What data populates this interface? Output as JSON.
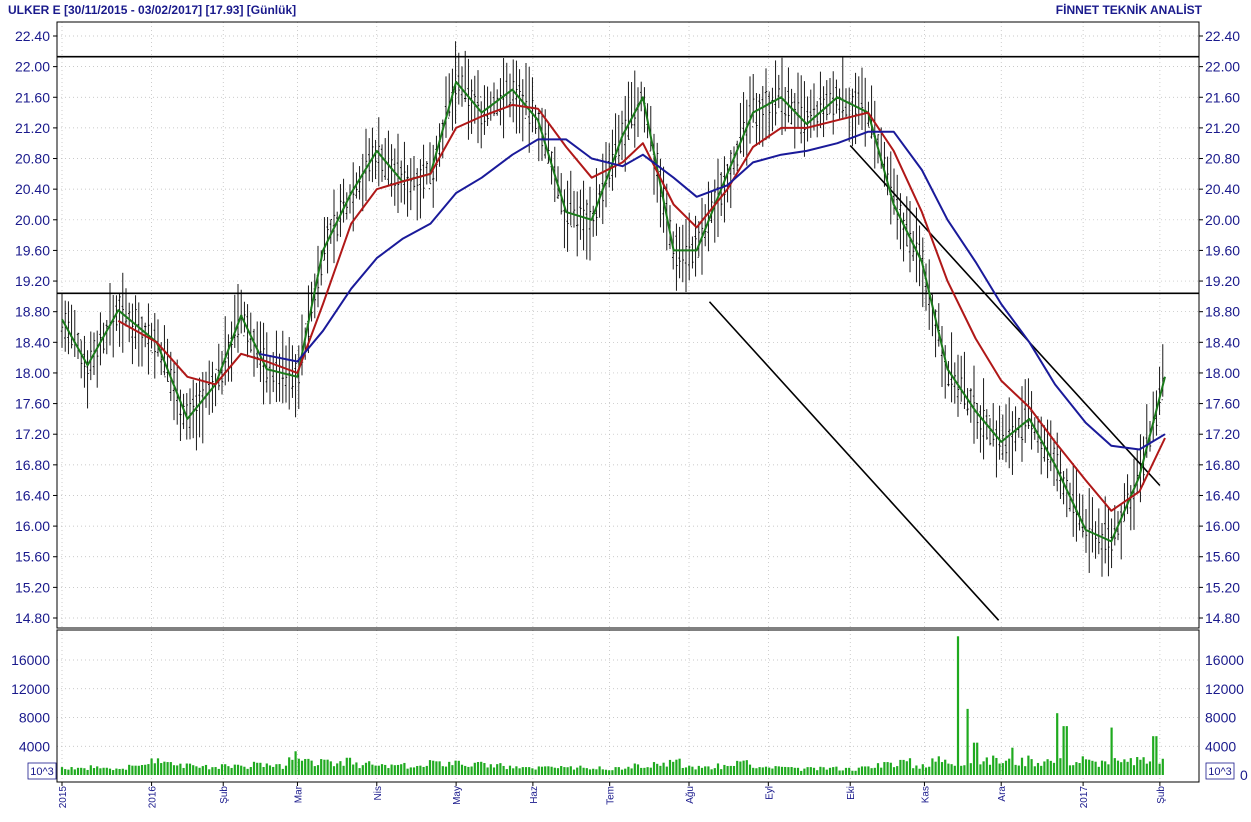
{
  "header": {
    "left": "ULKER E  [30/11/2015 - 03/02/2017]  [17.93]  [Günlük]",
    "right": "FİNNET TEKNİK ANALİST"
  },
  "volume_unit": "10^3",
  "colors": {
    "text": "#1a1a8c",
    "price_bars": "#000000",
    "ma_short": "#1a7a1a",
    "ma_mid": "#b01818",
    "ma_long": "#1a1a9a",
    "volume": "#1faa1f",
    "grid": "#b8b8b8"
  },
  "chart_data": [
    {
      "type": "ohlc_bar",
      "title": "ULKER E",
      "period": "30/11/2015 - 03/02/2017",
      "last": 17.93,
      "interval": "Günlük",
      "ylim": [
        14.75,
        22.55
      ],
      "yticks": [
        "22.40",
        "22.00",
        "21.60",
        "21.20",
        "20.80",
        "20.40",
        "20.00",
        "19.60",
        "19.20",
        "18.80",
        "18.40",
        "18.00",
        "17.60",
        "17.20",
        "16.80",
        "16.40",
        "16.00",
        "15.60",
        "15.20",
        "14.80"
      ],
      "xticks": [
        "2015",
        "2016",
        "Şub",
        "Mar",
        "Nis",
        "May",
        "Haz",
        "Tem",
        "Ağu",
        "Eyl",
        "Eki",
        "Kas",
        "Ara",
        "2017",
        "Şub"
      ],
      "grid": true,
      "horizontal_lines": [
        22.13,
        19.04
      ],
      "trend_lines": [
        {
          "from": {
            "date": "2016-08-09",
            "y": 18.93
          },
          "to": {
            "date": "2016-11-30",
            "y": 14.77
          }
        },
        {
          "from": {
            "date": "2016-10-03",
            "y": 20.97
          },
          "to": {
            "date": "2017-02-01",
            "y": 16.53
          }
        }
      ],
      "series": [
        {
          "name": "",
          "kind": "ma_short",
          "values": [
            [
              "2015-11-30",
              18.7
            ],
            [
              "2015-12-10",
              18.1
            ],
            [
              "2015-12-22",
              18.82
            ],
            [
              "2016-01-06",
              18.4
            ],
            [
              "2016-01-18",
              17.4
            ],
            [
              "2016-01-29",
              17.85
            ],
            [
              "2016-02-08",
              18.75
            ],
            [
              "2016-02-18",
              18.05
            ],
            [
              "2016-03-01",
              17.95
            ],
            [
              "2016-03-11",
              19.6
            ],
            [
              "2016-03-22",
              20.35
            ],
            [
              "2016-04-01",
              20.9
            ],
            [
              "2016-04-11",
              20.5
            ],
            [
              "2016-04-22",
              20.6
            ],
            [
              "2016-05-02",
              21.8
            ],
            [
              "2016-05-12",
              21.4
            ],
            [
              "2016-05-24",
              21.7
            ],
            [
              "2016-06-03",
              21.3
            ],
            [
              "2016-06-14",
              20.1
            ],
            [
              "2016-06-24",
              20.0
            ],
            [
              "2016-07-06",
              21.1
            ],
            [
              "2016-07-14",
              21.6
            ],
            [
              "2016-07-26",
              19.6
            ],
            [
              "2016-08-04",
              19.6
            ],
            [
              "2016-08-16",
              20.6
            ],
            [
              "2016-08-26",
              21.4
            ],
            [
              "2016-09-06",
              21.6
            ],
            [
              "2016-09-16",
              21.25
            ],
            [
              "2016-09-28",
              21.6
            ],
            [
              "2016-10-10",
              21.4
            ],
            [
              "2016-10-20",
              20.2
            ],
            [
              "2016-10-31",
              19.45
            ],
            [
              "2016-11-10",
              18.05
            ],
            [
              "2016-11-21",
              17.5
            ],
            [
              "2016-12-01",
              17.1
            ],
            [
              "2016-12-12",
              17.4
            ],
            [
              "2016-12-22",
              16.8
            ],
            [
              "2017-01-03",
              15.95
            ],
            [
              "2017-01-13",
              15.8
            ],
            [
              "2017-01-24",
              16.65
            ],
            [
              "2017-02-03",
              17.95
            ]
          ]
        },
        {
          "name": "",
          "kind": "ma_mid",
          "values": [
            [
              "2015-12-22",
              18.68
            ],
            [
              "2016-01-06",
              18.4
            ],
            [
              "2016-01-18",
              17.95
            ],
            [
              "2016-01-29",
              17.85
            ],
            [
              "2016-02-08",
              18.25
            ],
            [
              "2016-02-18",
              18.15
            ],
            [
              "2016-03-01",
              18.0
            ],
            [
              "2016-03-11",
              18.9
            ],
            [
              "2016-03-22",
              19.95
            ],
            [
              "2016-04-01",
              20.4
            ],
            [
              "2016-04-11",
              20.5
            ],
            [
              "2016-04-22",
              20.6
            ],
            [
              "2016-05-02",
              21.2
            ],
            [
              "2016-05-12",
              21.35
            ],
            [
              "2016-05-24",
              21.5
            ],
            [
              "2016-06-03",
              21.45
            ],
            [
              "2016-06-14",
              20.95
            ],
            [
              "2016-06-24",
              20.55
            ],
            [
              "2016-07-06",
              20.75
            ],
            [
              "2016-07-14",
              21.0
            ],
            [
              "2016-07-26",
              20.2
            ],
            [
              "2016-08-04",
              19.9
            ],
            [
              "2016-08-16",
              20.4
            ],
            [
              "2016-08-26",
              20.95
            ],
            [
              "2016-09-06",
              21.2
            ],
            [
              "2016-09-16",
              21.2
            ],
            [
              "2016-09-28",
              21.3
            ],
            [
              "2016-10-10",
              21.4
            ],
            [
              "2016-10-20",
              20.9
            ],
            [
              "2016-10-31",
              20.1
            ],
            [
              "2016-11-10",
              19.2
            ],
            [
              "2016-11-21",
              18.45
            ],
            [
              "2016-12-01",
              17.9
            ],
            [
              "2016-12-12",
              17.55
            ],
            [
              "2016-12-22",
              17.1
            ],
            [
              "2017-01-03",
              16.6
            ],
            [
              "2017-01-13",
              16.2
            ],
            [
              "2017-01-24",
              16.45
            ],
            [
              "2017-02-03",
              17.15
            ]
          ]
        },
        {
          "name": "",
          "kind": "ma_long",
          "values": [
            [
              "2016-02-15",
              18.25
            ],
            [
              "2016-03-01",
              18.15
            ],
            [
              "2016-03-11",
              18.55
            ],
            [
              "2016-03-22",
              19.1
            ],
            [
              "2016-04-01",
              19.5
            ],
            [
              "2016-04-11",
              19.75
            ],
            [
              "2016-04-22",
              19.95
            ],
            [
              "2016-05-02",
              20.35
            ],
            [
              "2016-05-12",
              20.55
            ],
            [
              "2016-05-24",
              20.85
            ],
            [
              "2016-06-03",
              21.05
            ],
            [
              "2016-06-14",
              21.05
            ],
            [
              "2016-06-24",
              20.8
            ],
            [
              "2016-07-06",
              20.7
            ],
            [
              "2016-07-14",
              20.85
            ],
            [
              "2016-07-26",
              20.55
            ],
            [
              "2016-08-04",
              20.3
            ],
            [
              "2016-08-16",
              20.45
            ],
            [
              "2016-08-26",
              20.75
            ],
            [
              "2016-09-06",
              20.85
            ],
            [
              "2016-09-16",
              20.9
            ],
            [
              "2016-09-28",
              21.0
            ],
            [
              "2016-10-10",
              21.15
            ],
            [
              "2016-10-20",
              21.15
            ],
            [
              "2016-10-31",
              20.65
            ],
            [
              "2016-11-10",
              20.0
            ],
            [
              "2016-11-21",
              19.45
            ],
            [
              "2016-12-01",
              18.9
            ],
            [
              "2016-12-12",
              18.4
            ],
            [
              "2016-12-22",
              17.85
            ],
            [
              "2017-01-03",
              17.35
            ],
            [
              "2017-01-13",
              17.05
            ],
            [
              "2017-01-24",
              17.0
            ],
            [
              "2017-02-03",
              17.2
            ]
          ]
        }
      ]
    },
    {
      "type": "bar",
      "title": "volume",
      "unit": "10^3",
      "ylim": [
        0,
        20000
      ],
      "yticks": [
        "16000",
        "12000",
        "8000",
        "4000",
        "0"
      ],
      "grid": true,
      "values": [
        [
          "2015-11-30",
          1100
        ],
        [
          "2015-12-07",
          1000
        ],
        [
          "2015-12-14",
          1200
        ],
        [
          "2015-12-21",
          900
        ],
        [
          "2015-12-28",
          1300
        ],
        [
          "2016-01-04",
          2300
        ],
        [
          "2016-01-11",
          1800
        ],
        [
          "2016-01-18",
          1600
        ],
        [
          "2016-01-25",
          1400
        ],
        [
          "2016-02-01",
          1500
        ],
        [
          "2016-02-08",
          1300
        ],
        [
          "2016-02-15",
          1700
        ],
        [
          "2016-02-22",
          1500
        ],
        [
          "2016-02-29",
          3300
        ],
        [
          "2016-03-07",
          2000
        ],
        [
          "2016-03-14",
          1900
        ],
        [
          "2016-03-21",
          2400
        ],
        [
          "2016-03-28",
          1700
        ],
        [
          "2016-04-04",
          1400
        ],
        [
          "2016-04-11",
          1500
        ],
        [
          "2016-04-18",
          1300
        ],
        [
          "2016-04-25",
          1900
        ],
        [
          "2016-05-02",
          2000
        ],
        [
          "2016-05-09",
          1700
        ],
        [
          "2016-05-16",
          1500
        ],
        [
          "2016-05-23",
          1300
        ],
        [
          "2016-05-30",
          1100
        ],
        [
          "2016-06-06",
          1200
        ],
        [
          "2016-06-13",
          1100
        ],
        [
          "2016-06-20",
          1300
        ],
        [
          "2016-06-27",
          1200
        ],
        [
          "2016-07-04",
          1100
        ],
        [
          "2016-07-11",
          1600
        ],
        [
          "2016-07-18",
          1800
        ],
        [
          "2016-07-25",
          2100
        ],
        [
          "2016-08-01",
          1300
        ],
        [
          "2016-08-08",
          1200
        ],
        [
          "2016-08-15",
          1400
        ],
        [
          "2016-08-22",
          2000
        ],
        [
          "2016-08-29",
          1100
        ],
        [
          "2016-09-05",
          1200
        ],
        [
          "2016-09-12",
          1000
        ],
        [
          "2016-09-19",
          1000
        ],
        [
          "2016-09-26",
          1100
        ],
        [
          "2016-10-03",
          1000
        ],
        [
          "2016-10-10",
          1200
        ],
        [
          "2016-10-17",
          1800
        ],
        [
          "2016-10-24",
          2100
        ],
        [
          "2016-10-31",
          1500
        ],
        [
          "2016-11-07",
          2600
        ],
        [
          "2016-11-14",
          19300
        ],
        [
          "2016-11-18",
          9200
        ],
        [
          "2016-11-21",
          4500
        ],
        [
          "2016-11-28",
          2700
        ],
        [
          "2016-12-05",
          3800
        ],
        [
          "2016-12-12",
          2700
        ],
        [
          "2016-12-19",
          2200
        ],
        [
          "2016-12-23",
          8600
        ],
        [
          "2016-12-26",
          6800
        ],
        [
          "2017-01-02",
          2600
        ],
        [
          "2017-01-09",
          2000
        ],
        [
          "2017-01-13",
          6600
        ],
        [
          "2017-01-16",
          2000
        ],
        [
          "2017-01-23",
          2500
        ],
        [
          "2017-01-30",
          5400
        ],
        [
          "2017-02-03",
          2200
        ]
      ]
    }
  ]
}
